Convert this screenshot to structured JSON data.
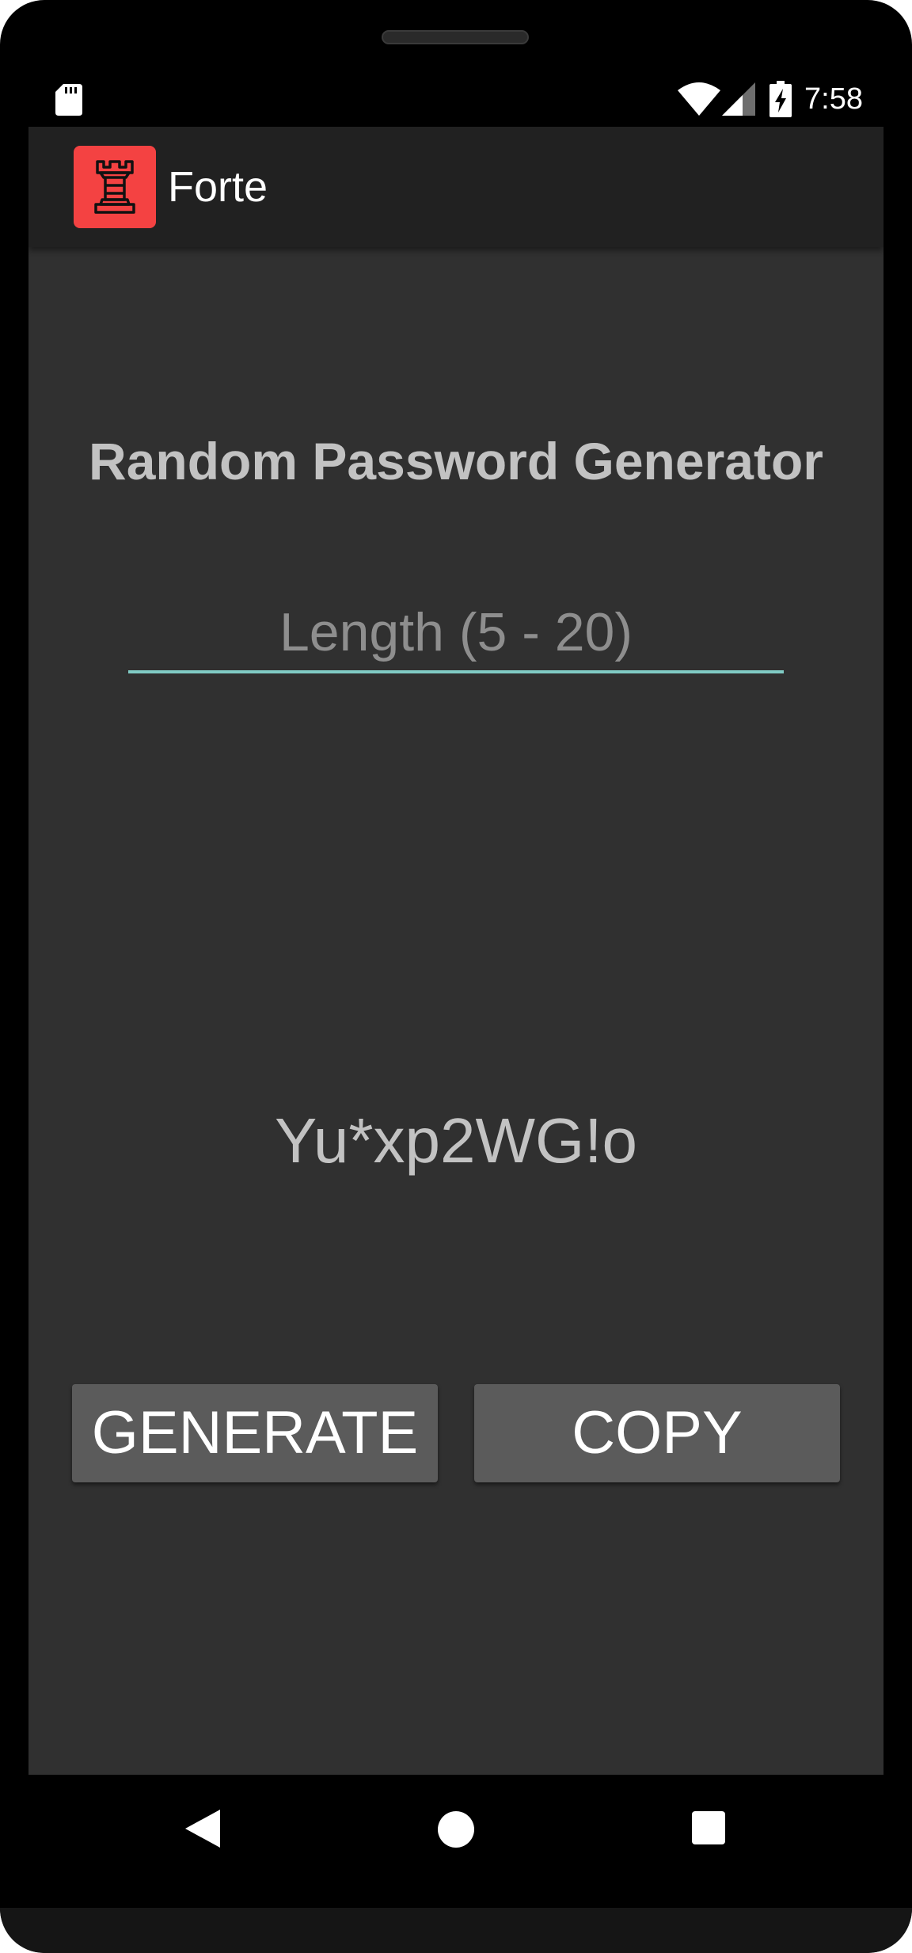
{
  "status_bar": {
    "time": "7:58",
    "icons": [
      "sd-card-icon",
      "wifi-icon",
      "cell-signal-icon",
      "battery-charging-icon"
    ]
  },
  "app_bar": {
    "title": "Forte",
    "logo_icon": "chess-rook-icon",
    "logo_color": "#f44242",
    "background": "#212121"
  },
  "main": {
    "heading": "Random Password Generator",
    "length_input": {
      "placeholder": "Length (5 - 20)",
      "value": ""
    },
    "generated_password": "Yu*xp2WG!o",
    "buttons": {
      "generate_label": "GENERATE",
      "copy_label": "COPY"
    },
    "accent_color": "#80cbc4",
    "background": "#303030"
  },
  "nav_bar": {
    "icons": [
      "back-icon",
      "home-icon",
      "recents-icon"
    ]
  }
}
